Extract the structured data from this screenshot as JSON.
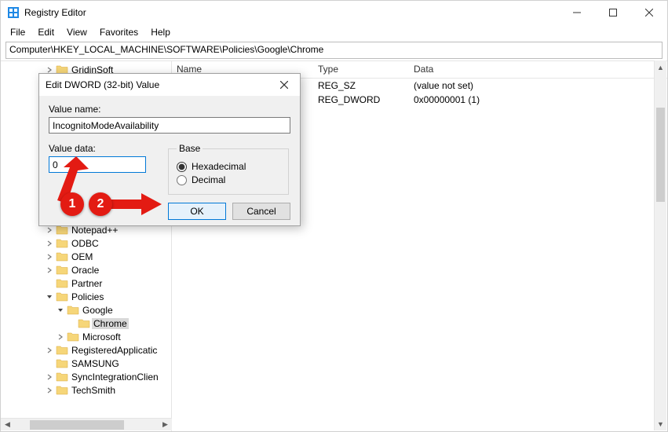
{
  "window": {
    "title": "Registry Editor",
    "minimize_name": "minimize",
    "maximize_name": "maximize",
    "close_name": "close"
  },
  "menu": {
    "items": [
      "File",
      "Edit",
      "View",
      "Favorites",
      "Help"
    ]
  },
  "addressbar": {
    "path": "Computer\\HKEY_LOCAL_MACHINE\\SOFTWARE\\Policies\\Google\\Chrome"
  },
  "tree": {
    "items": [
      {
        "indent": 4,
        "expander": ">",
        "label": "GridinSoft"
      },
      {
        "indent": 4,
        "expander": "",
        "label": ""
      },
      {
        "indent": 4,
        "expander": "",
        "label": ""
      },
      {
        "indent": 4,
        "expander": "",
        "label": ""
      },
      {
        "indent": 4,
        "expander": "",
        "label": ""
      },
      {
        "indent": 4,
        "expander": "",
        "label": ""
      },
      {
        "indent": 4,
        "expander": "",
        "label": ""
      },
      {
        "indent": 4,
        "expander": "",
        "label": ""
      },
      {
        "indent": 4,
        "expander": "",
        "label": ""
      },
      {
        "indent": 4,
        "expander": "",
        "label": ""
      },
      {
        "indent": 4,
        "expander": "",
        "label": ""
      },
      {
        "indent": 4,
        "expander": "",
        "label": ""
      },
      {
        "indent": 4,
        "expander": ">",
        "label": "Notepad++"
      },
      {
        "indent": 4,
        "expander": ">",
        "label": "ODBC"
      },
      {
        "indent": 4,
        "expander": ">",
        "label": "OEM"
      },
      {
        "indent": 4,
        "expander": ">",
        "label": "Oracle"
      },
      {
        "indent": 4,
        "expander": "",
        "label": "Partner"
      },
      {
        "indent": 4,
        "expander": "v",
        "label": "Policies"
      },
      {
        "indent": 5,
        "expander": "v",
        "label": "Google"
      },
      {
        "indent": 6,
        "expander": "",
        "label": "Chrome",
        "selected": true
      },
      {
        "indent": 5,
        "expander": ">",
        "label": "Microsoft"
      },
      {
        "indent": 4,
        "expander": ">",
        "label": "RegisteredApplicatic"
      },
      {
        "indent": 4,
        "expander": "",
        "label": "SAMSUNG"
      },
      {
        "indent": 4,
        "expander": ">",
        "label": "SyncIntegrationClien"
      },
      {
        "indent": 4,
        "expander": ">",
        "label": "TechSmith"
      }
    ]
  },
  "listview": {
    "columns": [
      "Name",
      "Type",
      "Data"
    ],
    "rows": [
      {
        "type": "REG_SZ",
        "data": "(value not set)"
      },
      {
        "type": "REG_DWORD",
        "data": "0x00000001 (1)"
      }
    ]
  },
  "dialog": {
    "title": "Edit DWORD (32-bit) Value",
    "value_name_label": "Value name:",
    "value_name": "IncognitoModeAvailability",
    "value_data_label": "Value data:",
    "value_data": "0",
    "base_label": "Base",
    "hex_label": "Hexadecimal",
    "dec_label": "Decimal",
    "hex_checked": true,
    "ok_label": "OK",
    "cancel_label": "Cancel"
  },
  "annotation": {
    "step1": "1",
    "step2": "2"
  }
}
